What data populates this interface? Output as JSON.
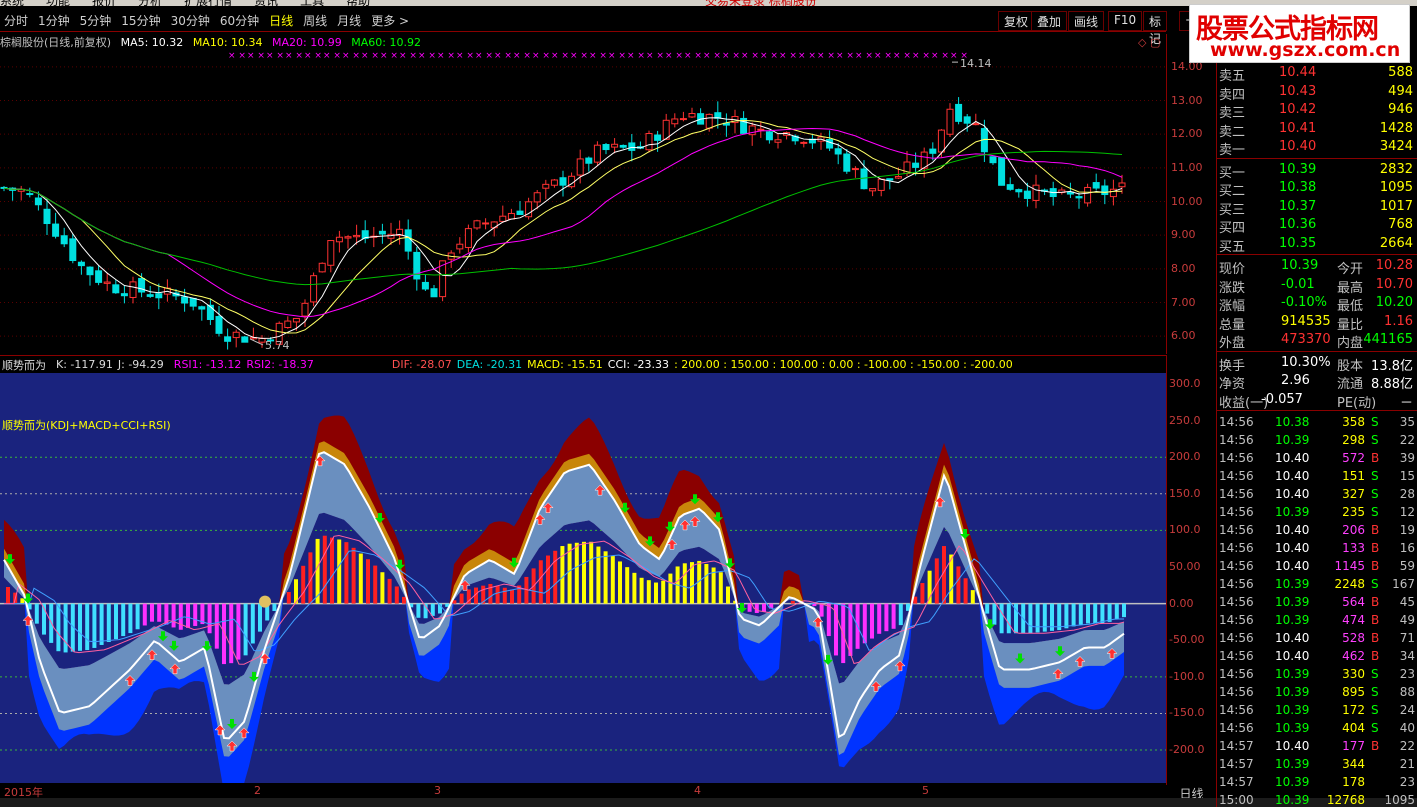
{
  "menubar": {
    "items": [
      "系统",
      "功能",
      "报价",
      "分析",
      "扩展行情",
      "资讯",
      "工具",
      "帮助"
    ],
    "title": "交易未登录  棕榈股份"
  },
  "topbar": {
    "periods": [
      "分时",
      "1分钟",
      "5分钟",
      "15分钟",
      "30分钟",
      "60分钟",
      "日线",
      "周线",
      "月线",
      "更多 >"
    ],
    "active": "日线",
    "right_buttons": [
      "复权",
      "叠加",
      "画线",
      "F10",
      "标记",
      "+"
    ]
  },
  "logo": {
    "line1": "股票公式指标网",
    "line2": "www.gszx.com.cn"
  },
  "chart_header": {
    "name": "棕榈股份(日线,前复权)",
    "ma5": "MA5: 10.32",
    "ma10": "MA10: 10.34",
    "ma20": "MA20: 10.99",
    "ma60": "MA60: 10.92"
  },
  "price_axis": [
    "14.00",
    "13.00",
    "12.00",
    "11.00",
    "10.00",
    "9.00",
    "8.00",
    "7.00",
    "6.00"
  ],
  "annotations": {
    "high": "14.14",
    "low": "5.74"
  },
  "indicator_header": {
    "name": "顺势而为",
    "k": "K: -117.91",
    "j": "J: -94.29",
    "rsi1": "RSI1: -13.12",
    "rsi2": "RSI2: -18.37",
    "dif": "DIF: -28.07",
    "dea": "DEA: -20.31",
    "macd": "MACD: -15.51",
    "cci": "CCI: -23.33",
    "levels": ": 200.00  : 150.00  : 100.00  : 0.00  : -100.00  : -150.00  : -200.00"
  },
  "indicator_title": "顺势而为(KDJ+MACD+CCI+RSI)",
  "ind_axis": [
    "300.0",
    "250.0",
    "200.0",
    "150.0",
    "100.0",
    "50.00",
    "0.00",
    "-50.00",
    "-100.0",
    "-150.0",
    "-200.0"
  ],
  "xaxis": [
    "2015年",
    "2",
    "3",
    "4",
    "5"
  ],
  "dayk": "日线",
  "orderbook": {
    "sell": [
      {
        "l": "卖五",
        "p": "10.44",
        "v": "588"
      },
      {
        "l": "卖四",
        "p": "10.43",
        "v": "494"
      },
      {
        "l": "卖三",
        "p": "10.42",
        "v": "946"
      },
      {
        "l": "卖二",
        "p": "10.41",
        "v": "1428"
      },
      {
        "l": "卖一",
        "p": "10.40",
        "v": "3424"
      }
    ],
    "buy": [
      {
        "l": "买一",
        "p": "10.39",
        "v": "2832"
      },
      {
        "l": "买二",
        "p": "10.38",
        "v": "1095"
      },
      {
        "l": "买三",
        "p": "10.37",
        "v": "1017"
      },
      {
        "l": "买四",
        "p": "10.36",
        "v": "768"
      },
      {
        "l": "买五",
        "p": "10.35",
        "v": "2664"
      }
    ]
  },
  "stats": [
    {
      "l": "现价",
      "v": "10.39",
      "l2": "今开",
      "v2": "10.28"
    },
    {
      "l": "涨跌",
      "v": "-0.01",
      "l2": "最高",
      "v2": "10.70"
    },
    {
      "l": "涨幅",
      "v": "-0.10%",
      "l2": "最低",
      "v2": "10.20"
    },
    {
      "l": "总量",
      "v": "914535",
      "l2": "量比",
      "v2": "1.16"
    },
    {
      "l": "外盘",
      "v": "473370",
      "l2": "内盘",
      "v2": "441165"
    }
  ],
  "stats2": [
    {
      "l": "换手",
      "v": "10.30%",
      "l2": "股本",
      "v2": "13.8亿"
    },
    {
      "l": "净资",
      "v": "2.96",
      "l2": "流通",
      "v2": "8.88亿"
    },
    {
      "l": "收益(一)",
      "v": "-0.057",
      "l2": "PE(动)",
      "v2": "－"
    }
  ],
  "trades": [
    {
      "t": "14:56",
      "p": "10.38",
      "v": "358",
      "s": "S",
      "n": "35"
    },
    {
      "t": "14:56",
      "p": "10.39",
      "v": "298",
      "s": "S",
      "n": "22"
    },
    {
      "t": "14:56",
      "p": "10.40",
      "v": "572",
      "s": "B",
      "n": "39"
    },
    {
      "t": "14:56",
      "p": "10.40",
      "v": "151",
      "s": "S",
      "n": "15"
    },
    {
      "t": "14:56",
      "p": "10.40",
      "v": "327",
      "s": "S",
      "n": "28"
    },
    {
      "t": "14:56",
      "p": "10.39",
      "v": "235",
      "s": "S",
      "n": "12"
    },
    {
      "t": "14:56",
      "p": "10.40",
      "v": "206",
      "s": "B",
      "n": "19"
    },
    {
      "t": "14:56",
      "p": "10.40",
      "v": "133",
      "s": "B",
      "n": "16"
    },
    {
      "t": "14:56",
      "p": "10.40",
      "v": "1145",
      "s": "B",
      "n": "59"
    },
    {
      "t": "14:56",
      "p": "10.39",
      "v": "2248",
      "s": "S",
      "n": "167"
    },
    {
      "t": "14:56",
      "p": "10.39",
      "v": "564",
      "s": "B",
      "n": "45"
    },
    {
      "t": "14:56",
      "p": "10.39",
      "v": "474",
      "s": "B",
      "n": "49"
    },
    {
      "t": "14:56",
      "p": "10.40",
      "v": "528",
      "s": "B",
      "n": "71"
    },
    {
      "t": "14:56",
      "p": "10.40",
      "v": "462",
      "s": "B",
      "n": "34"
    },
    {
      "t": "14:56",
      "p": "10.39",
      "v": "330",
      "s": "S",
      "n": "23"
    },
    {
      "t": "14:56",
      "p": "10.39",
      "v": "895",
      "s": "S",
      "n": "88"
    },
    {
      "t": "14:56",
      "p": "10.39",
      "v": "172",
      "s": "S",
      "n": "24"
    },
    {
      "t": "14:56",
      "p": "10.39",
      "v": "404",
      "s": "S",
      "n": "40"
    },
    {
      "t": "14:57",
      "p": "10.40",
      "v": "177",
      "s": "B",
      "n": "22"
    },
    {
      "t": "14:57",
      "p": "10.39",
      "v": "344",
      "s": "",
      "n": "21"
    },
    {
      "t": "14:57",
      "p": "10.39",
      "v": "178",
      "s": "",
      "n": "23"
    },
    {
      "t": "15:00",
      "p": "10.39",
      "v": "12768",
      "s": "",
      "n": "1095"
    }
  ],
  "colors": {
    "up": "#ff3232",
    "down": "#00e0e0",
    "yellow": "#ffff00",
    "green": "#00ff00",
    "magenta": "#ff00ff",
    "white": "#ffffff"
  }
}
